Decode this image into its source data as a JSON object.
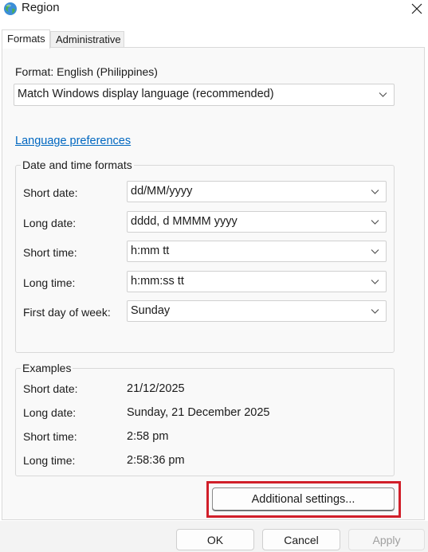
{
  "window": {
    "title": "Region",
    "app_icon": "globe-icon",
    "close_icon": "close-icon"
  },
  "tabs": [
    {
      "label": "Formats",
      "active": true
    },
    {
      "label": "Administrative",
      "active": false
    }
  ],
  "format": {
    "label": "Format: English (Philippines)",
    "selected": "Match Windows display language (recommended)"
  },
  "language_link": "Language preferences",
  "date_time_formats": {
    "title": "Date and time formats",
    "rows": [
      {
        "label": "Short date:",
        "value": "dd/MM/yyyy"
      },
      {
        "label": "Long date:",
        "value": "dddd, d MMMM yyyy"
      },
      {
        "label": "Short time:",
        "value": "h:mm tt"
      },
      {
        "label": "Long time:",
        "value": "h:mm:ss tt"
      },
      {
        "label": "First day of week:",
        "value": "Sunday"
      }
    ]
  },
  "examples": {
    "title": "Examples",
    "rows": [
      {
        "label": "Short date:",
        "value": "21/12/2025"
      },
      {
        "label": "Long date:",
        "value": "Sunday, 21 December 2025"
      },
      {
        "label": "Short time:",
        "value": "2:58 pm"
      },
      {
        "label": "Long time:",
        "value": "2:58:36 pm"
      }
    ]
  },
  "buttons": {
    "additional_settings": "Additional settings...",
    "ok": "OK",
    "cancel": "Cancel",
    "apply": "Apply"
  },
  "colors": {
    "highlight": "#d11f2a",
    "link": "#0067c0"
  }
}
